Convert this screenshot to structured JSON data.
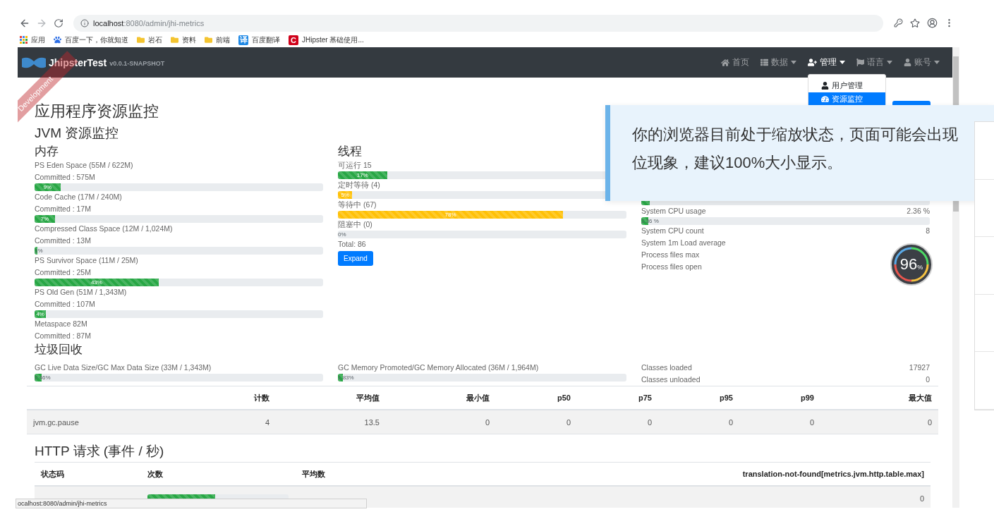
{
  "browser": {
    "url_host": "localhost",
    "url_path": ":8080/admin/jhi-metrics",
    "bookmarks": [
      {
        "kind": "apps",
        "label": "应用"
      },
      {
        "kind": "paw",
        "label": "百度一下，你就知道"
      },
      {
        "kind": "folder",
        "label": "岩石"
      },
      {
        "kind": "folder",
        "label": "资料"
      },
      {
        "kind": "folder",
        "label": "前端"
      },
      {
        "kind": "translate",
        "icon_text": "译",
        "label": "百度翻译"
      },
      {
        "kind": "letter",
        "icon_text": "C",
        "label": "JHipster 基础使用..."
      }
    ]
  },
  "navbar": {
    "brand": "JhipsterTest",
    "version": "v0.0.1-SNAPSHOT",
    "ribbon": "Development",
    "items": [
      {
        "kind": "home",
        "label": "首页",
        "selected": false,
        "dropdown": false
      },
      {
        "kind": "list",
        "label": "数据",
        "selected": false,
        "dropdown": true
      },
      {
        "kind": "user-plus",
        "label": "管理",
        "selected": true,
        "dropdown": true
      },
      {
        "kind": "flag",
        "label": "语言",
        "selected": false,
        "dropdown": true
      },
      {
        "kind": "user",
        "label": "账号",
        "selected": false,
        "dropdown": true
      }
    ],
    "menu": [
      {
        "kind": "user",
        "label": "用户管理",
        "selected": false
      },
      {
        "kind": "gauge",
        "label": "资源监控",
        "selected": true
      }
    ]
  },
  "page": {
    "title": "应用程序资源监控",
    "subtitle": "JVM 资源监控"
  },
  "memory": {
    "heading": "内存",
    "items": [
      {
        "label": "PS Eden Space (55M / 622M)",
        "committed": "Committed : 575M",
        "level": 0.09,
        "percent": "9%"
      },
      {
        "label": "Code Cache (17M / 240M)",
        "committed": "Committed : 17M",
        "level": 0.07,
        "percent": "7%"
      },
      {
        "label": "Compressed Class Space (12M / 1,024M)",
        "committed": "Committed : 13M",
        "level": 0.01,
        "percent": "1%"
      },
      {
        "label": "PS Survivor Space (11M / 25M)",
        "committed": "Committed : 25M",
        "level": 0.43,
        "percent": "43%"
      },
      {
        "label": "PS Old Gen (51M / 1,343M)",
        "committed": "Committed : 107M",
        "level": 0.04,
        "percent": "4%"
      },
      {
        "label": "Metaspace 82M",
        "committed": "Committed : 87M"
      }
    ]
  },
  "threads": {
    "heading": "线程",
    "items": [
      {
        "label": "可运行 15",
        "level": 0.17,
        "percent": "17%",
        "color": "#28a745"
      },
      {
        "label": "定时等待 (4)",
        "level": 0.05,
        "percent": "5%",
        "color": "#ffc107"
      },
      {
        "label": "等待中 (67)",
        "level": 0.78,
        "percent": "78%",
        "color": "#ffc107"
      },
      {
        "label": "阻塞中 (0)",
        "level": 0,
        "percent": "0%"
      }
    ],
    "total": "Total: 86",
    "button": "Expand"
  },
  "system": {
    "items": [
      {
        "kind": "bar",
        "level": 0.03
      },
      {
        "kind": "stat",
        "label": "System CPU usage",
        "value": "2.36 %"
      },
      {
        "kind": "bar",
        "level": 0.0236,
        "percent": "2.36 %"
      },
      {
        "kind": "stat",
        "label": "System CPU count",
        "value": "8"
      },
      {
        "kind": "stat",
        "label": "System 1m Load average"
      },
      {
        "kind": "stat",
        "label": "Process files max"
      },
      {
        "kind": "stat",
        "label": "Process files open"
      }
    ]
  },
  "gc": {
    "heading": "垃圾回收",
    "bars": [
      {
        "label": "GC Live Data Size/GC Max Data Size (33M / 1,343M)",
        "level": 0.0246,
        "percent": "2.46%"
      },
      {
        "label": "GC Memory Promoted/GC Memory Allocated (36M / 1,964M)",
        "level": 0.0183,
        "percent": "1.83%"
      }
    ],
    "stats": [
      {
        "label": "Classes loaded",
        "value": "17927"
      },
      {
        "label": "Classes unloaded",
        "value": "0"
      }
    ],
    "table": {
      "columns": [
        "计数",
        "平均值",
        "最小值",
        "p50",
        "p75",
        "p95",
        "p99",
        "最大值"
      ],
      "rows": [
        {
          "name": "jvm.gc.pause",
          "cells": [
            "4",
            "13.5",
            "0",
            "0",
            "0",
            "0",
            "0",
            "0"
          ]
        }
      ]
    }
  },
  "http": {
    "heading": "HTTP 请求 (事件 / 秒)",
    "columns": [
      "状态码",
      "次数",
      "平均数",
      "translation-not-found[metrics.jvm.http.table.max]"
    ],
    "rows": [
      {
        "level": 0.48,
        "max": "0"
      }
    ]
  },
  "notice": {
    "lines": [
      "你的浏览器目前处于缩放状态，页面可能会出现",
      "位现象，建议100%大小显示。"
    ]
  },
  "gauge": {
    "value": "96",
    "unit": "%"
  },
  "status_url": "ocalhost:8080/admin/jhi-metrics"
}
